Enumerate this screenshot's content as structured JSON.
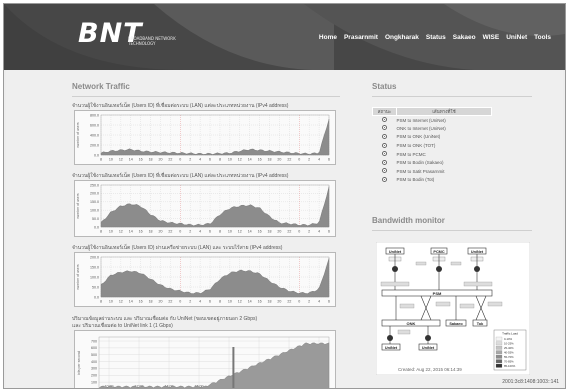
{
  "header": {
    "logo": "BNT",
    "tagline": "BROADBAND NETWORK TECHNOLOGY",
    "nav": [
      "Home",
      "Prasarnmit",
      "Ongkharak",
      "Status",
      "Sakaeo",
      "WISE",
      "UniNet",
      "Tools"
    ]
  },
  "traffic": {
    "title": "Network Traffic",
    "charts": [
      {
        "caption": "จำนวนผู้ใช้งานอินเทอร์เน็ต (Users ID) ที่เชื่อมต่อระบบ (LAN) แต่ละประเภทหน่วยงาน (IPv4 address)",
        "ylabel": "number of users",
        "y_ticks": [
          "800.0",
          "600.0",
          "400.0",
          "200.0",
          "0.0"
        ]
      },
      {
        "caption": "จำนวนผู้ใช้งานอินเทอร์เน็ต (Users ID) ที่เชื่อมต่อระบบ (LAN) แต่ละประเภทหน่วยงาน (IPv4 address)",
        "ylabel": "number of users",
        "y_ticks": [
          "250.0",
          "200.0",
          "150.0",
          "100.0",
          "50.0",
          "0.0"
        ]
      },
      {
        "caption": "จำนวนผู้ใช้งานอินเทอร์เน็ต (Users ID) ผ่านเครือข่ายระบบ (LAN) และ ระบบไร้สาย (IPv4 address)",
        "ylabel": "number of users",
        "y_ticks": [
          "200.0",
          "150.0",
          "100.0",
          "50.0",
          "0.0"
        ]
      }
    ],
    "x_ticks": [
      "8",
      "10",
      "12",
      "14",
      "16",
      "18",
      "20",
      "22",
      "0",
      "2",
      "4",
      "6",
      "8",
      "10",
      "12",
      "14",
      "16",
      "18",
      "20",
      "22",
      "0",
      "2",
      "4",
      "6"
    ],
    "bandwidth_caption_1": "ปริมาณข้อมูลผ่านระบบ และ ปริมาณเชื่อมต่อ กับ UniNet (ขอบเขตอยู่ภายนอก 2 Gbps)",
    "bandwidth_caption_2": "และ ปริมาณเชื่อมต่อ to UniNet link 1 (1 Gbps)",
    "bandwidth_ylabel": "bits per second",
    "bandwidth_y_ticks": [
      "700",
      "600",
      "500",
      "400",
      "300",
      "200",
      "100"
    ],
    "bandwidth_x_ticks": [
      "10:00",
      "12:00",
      "14:00",
      "16:00",
      "18:00",
      "20:00",
      "22:00",
      "00:00"
    ]
  },
  "status": {
    "title": "Status",
    "table_headers": [
      "สถานะ",
      "เส้นทางที่ใช้"
    ],
    "rows": [
      "PSM to Internet (UniNet)",
      "ONK to Internet (UniNet)",
      "PSM to ONK (UniNet)",
      "PSM to ONK (TOT)",
      "PSM to PCMC",
      "PSM to Bodin (Sakaeo)",
      "PSM to Satit Prasarnmit",
      "PSM to Bodin (Tot)"
    ]
  },
  "bandwidth_monitor": {
    "title": "Bandwidth monitor",
    "nodes": [
      "UniNet",
      "PCMC",
      "UniNet",
      "PSM",
      "ONK",
      "Sakaeo",
      "Tok",
      "UniNet",
      "UniNet"
    ],
    "legend_title": "Traffic Load",
    "legend_items": [
      "0-10%",
      "10-25%",
      "25-40%",
      "40-55%",
      "55-70%",
      "70-85%",
      "85-100%"
    ],
    "note": "Created: Aug 22, 2015 06:14:39"
  },
  "footer": {
    "ip": "2001:3c8:1408:1003::141"
  },
  "colors": {
    "header_bg": "#4a4a4a",
    "chart_fill": "#8c8c8c",
    "chart_bg": "#fafafa"
  }
}
